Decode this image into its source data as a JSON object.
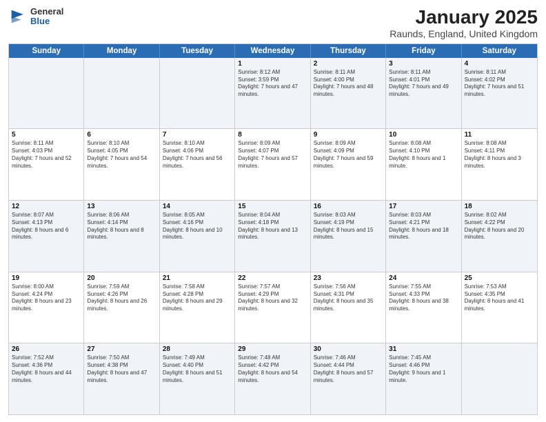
{
  "header": {
    "logo_general": "General",
    "logo_blue": "Blue",
    "title": "January 2025",
    "subtitle": "Raunds, England, United Kingdom"
  },
  "days_of_week": [
    "Sunday",
    "Monday",
    "Tuesday",
    "Wednesday",
    "Thursday",
    "Friday",
    "Saturday"
  ],
  "weeks": [
    [
      {
        "day": "",
        "info": ""
      },
      {
        "day": "",
        "info": ""
      },
      {
        "day": "",
        "info": ""
      },
      {
        "day": "1",
        "info": "Sunrise: 8:12 AM\nSunset: 3:59 PM\nDaylight: 7 hours and 47 minutes."
      },
      {
        "day": "2",
        "info": "Sunrise: 8:11 AM\nSunset: 4:00 PM\nDaylight: 7 hours and 48 minutes."
      },
      {
        "day": "3",
        "info": "Sunrise: 8:11 AM\nSunset: 4:01 PM\nDaylight: 7 hours and 49 minutes."
      },
      {
        "day": "4",
        "info": "Sunrise: 8:11 AM\nSunset: 4:02 PM\nDaylight: 7 hours and 51 minutes."
      }
    ],
    [
      {
        "day": "5",
        "info": "Sunrise: 8:11 AM\nSunset: 4:03 PM\nDaylight: 7 hours and 52 minutes."
      },
      {
        "day": "6",
        "info": "Sunrise: 8:10 AM\nSunset: 4:05 PM\nDaylight: 7 hours and 54 minutes."
      },
      {
        "day": "7",
        "info": "Sunrise: 8:10 AM\nSunset: 4:06 PM\nDaylight: 7 hours and 56 minutes."
      },
      {
        "day": "8",
        "info": "Sunrise: 8:09 AM\nSunset: 4:07 PM\nDaylight: 7 hours and 57 minutes."
      },
      {
        "day": "9",
        "info": "Sunrise: 8:09 AM\nSunset: 4:09 PM\nDaylight: 7 hours and 59 minutes."
      },
      {
        "day": "10",
        "info": "Sunrise: 8:08 AM\nSunset: 4:10 PM\nDaylight: 8 hours and 1 minute."
      },
      {
        "day": "11",
        "info": "Sunrise: 8:08 AM\nSunset: 4:11 PM\nDaylight: 8 hours and 3 minutes."
      }
    ],
    [
      {
        "day": "12",
        "info": "Sunrise: 8:07 AM\nSunset: 4:13 PM\nDaylight: 8 hours and 6 minutes."
      },
      {
        "day": "13",
        "info": "Sunrise: 8:06 AM\nSunset: 4:14 PM\nDaylight: 8 hours and 8 minutes."
      },
      {
        "day": "14",
        "info": "Sunrise: 8:05 AM\nSunset: 4:16 PM\nDaylight: 8 hours and 10 minutes."
      },
      {
        "day": "15",
        "info": "Sunrise: 8:04 AM\nSunset: 4:18 PM\nDaylight: 8 hours and 13 minutes."
      },
      {
        "day": "16",
        "info": "Sunrise: 8:03 AM\nSunset: 4:19 PM\nDaylight: 8 hours and 15 minutes."
      },
      {
        "day": "17",
        "info": "Sunrise: 8:03 AM\nSunset: 4:21 PM\nDaylight: 8 hours and 18 minutes."
      },
      {
        "day": "18",
        "info": "Sunrise: 8:02 AM\nSunset: 4:22 PM\nDaylight: 8 hours and 20 minutes."
      }
    ],
    [
      {
        "day": "19",
        "info": "Sunrise: 8:00 AM\nSunset: 4:24 PM\nDaylight: 8 hours and 23 minutes."
      },
      {
        "day": "20",
        "info": "Sunrise: 7:59 AM\nSunset: 4:26 PM\nDaylight: 8 hours and 26 minutes."
      },
      {
        "day": "21",
        "info": "Sunrise: 7:58 AM\nSunset: 4:28 PM\nDaylight: 8 hours and 29 minutes."
      },
      {
        "day": "22",
        "info": "Sunrise: 7:57 AM\nSunset: 4:29 PM\nDaylight: 8 hours and 32 minutes."
      },
      {
        "day": "23",
        "info": "Sunrise: 7:56 AM\nSunset: 4:31 PM\nDaylight: 8 hours and 35 minutes."
      },
      {
        "day": "24",
        "info": "Sunrise: 7:55 AM\nSunset: 4:33 PM\nDaylight: 8 hours and 38 minutes."
      },
      {
        "day": "25",
        "info": "Sunrise: 7:53 AM\nSunset: 4:35 PM\nDaylight: 8 hours and 41 minutes."
      }
    ],
    [
      {
        "day": "26",
        "info": "Sunrise: 7:52 AM\nSunset: 4:36 PM\nDaylight: 8 hours and 44 minutes."
      },
      {
        "day": "27",
        "info": "Sunrise: 7:50 AM\nSunset: 4:38 PM\nDaylight: 8 hours and 47 minutes."
      },
      {
        "day": "28",
        "info": "Sunrise: 7:49 AM\nSunset: 4:40 PM\nDaylight: 8 hours and 51 minutes."
      },
      {
        "day": "29",
        "info": "Sunrise: 7:48 AM\nSunset: 4:42 PM\nDaylight: 8 hours and 54 minutes."
      },
      {
        "day": "30",
        "info": "Sunrise: 7:46 AM\nSunset: 4:44 PM\nDaylight: 8 hours and 57 minutes."
      },
      {
        "day": "31",
        "info": "Sunrise: 7:45 AM\nSunset: 4:46 PM\nDaylight: 9 hours and 1 minute."
      },
      {
        "day": "",
        "info": ""
      }
    ]
  ],
  "alt_weeks": [
    0,
    2,
    4
  ]
}
